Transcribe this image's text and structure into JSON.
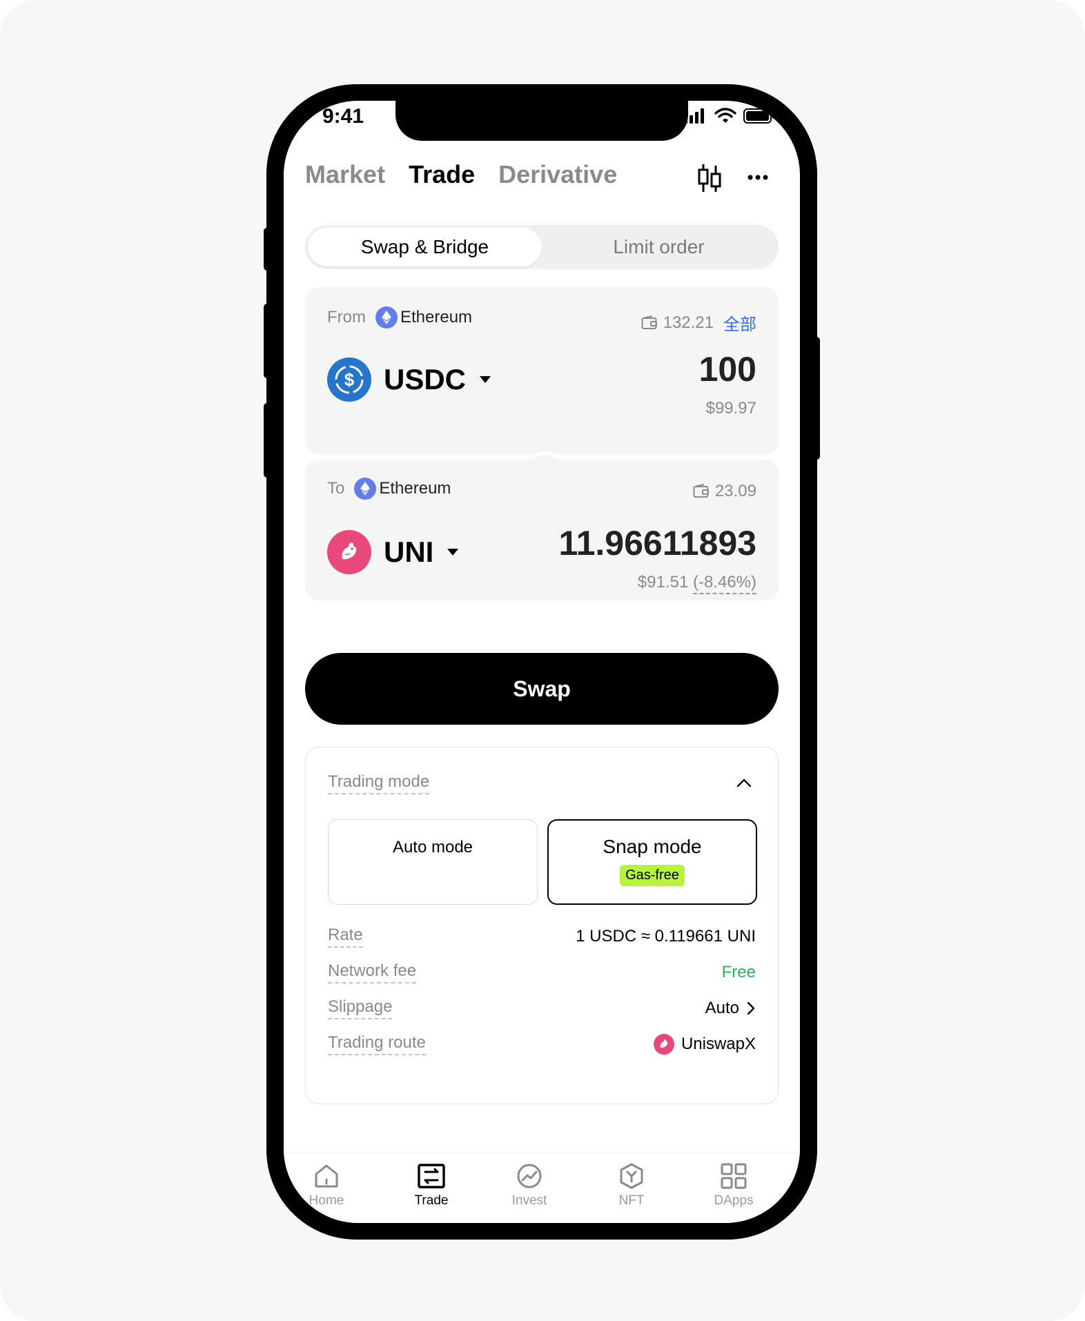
{
  "status_bar": {
    "time": "9:41"
  },
  "header": {
    "tabs": [
      {
        "label": "Market",
        "active": false
      },
      {
        "label": "Trade",
        "active": true
      },
      {
        "label": "Derivative",
        "active": false
      }
    ],
    "icons": [
      "candlestick-chart-icon",
      "more-icon"
    ]
  },
  "segment": {
    "left_label": "Swap & Bridge",
    "right_label": "Limit order",
    "active": "Swap & Bridge"
  },
  "from": {
    "label": "From",
    "network": "Ethereum",
    "balance": "132.21",
    "max_label": "全部",
    "token": "USDC",
    "amount": "100",
    "usd": "$99.97"
  },
  "to": {
    "label": "To",
    "network": "Ethereum",
    "balance": "23.09",
    "token": "UNI",
    "amount": "11.96611893",
    "usd": "$91.51",
    "change": "(-8.46%)"
  },
  "swap_button": {
    "label": "Swap"
  },
  "trading": {
    "title": "Trading mode",
    "auto_label": "Auto mode",
    "snap_label": "Snap mode",
    "snap_badge": "Gas-free",
    "selected_mode": "Snap mode",
    "rate_label": "Rate",
    "rate_value": "1 USDC ≈ 0.119661 UNI",
    "fee_label": "Network fee",
    "fee_value": "Free",
    "slippage_label": "Slippage",
    "slippage_value": "Auto",
    "route_label": "Trading route",
    "route_value": "UniswapX"
  },
  "bottom_nav": {
    "home": "Home",
    "trade": "Trade",
    "invest": "Invest",
    "nft": "NFT",
    "dapps": "DApps",
    "active": "Trade"
  },
  "colors": {
    "accent_link": "#2f6bff",
    "free_green": "#22b85a",
    "gas_badge": "#b6f33e",
    "usdc_blue": "#2775ca",
    "uni_pink": "#e8497a",
    "eth_purple": "#627eea"
  }
}
